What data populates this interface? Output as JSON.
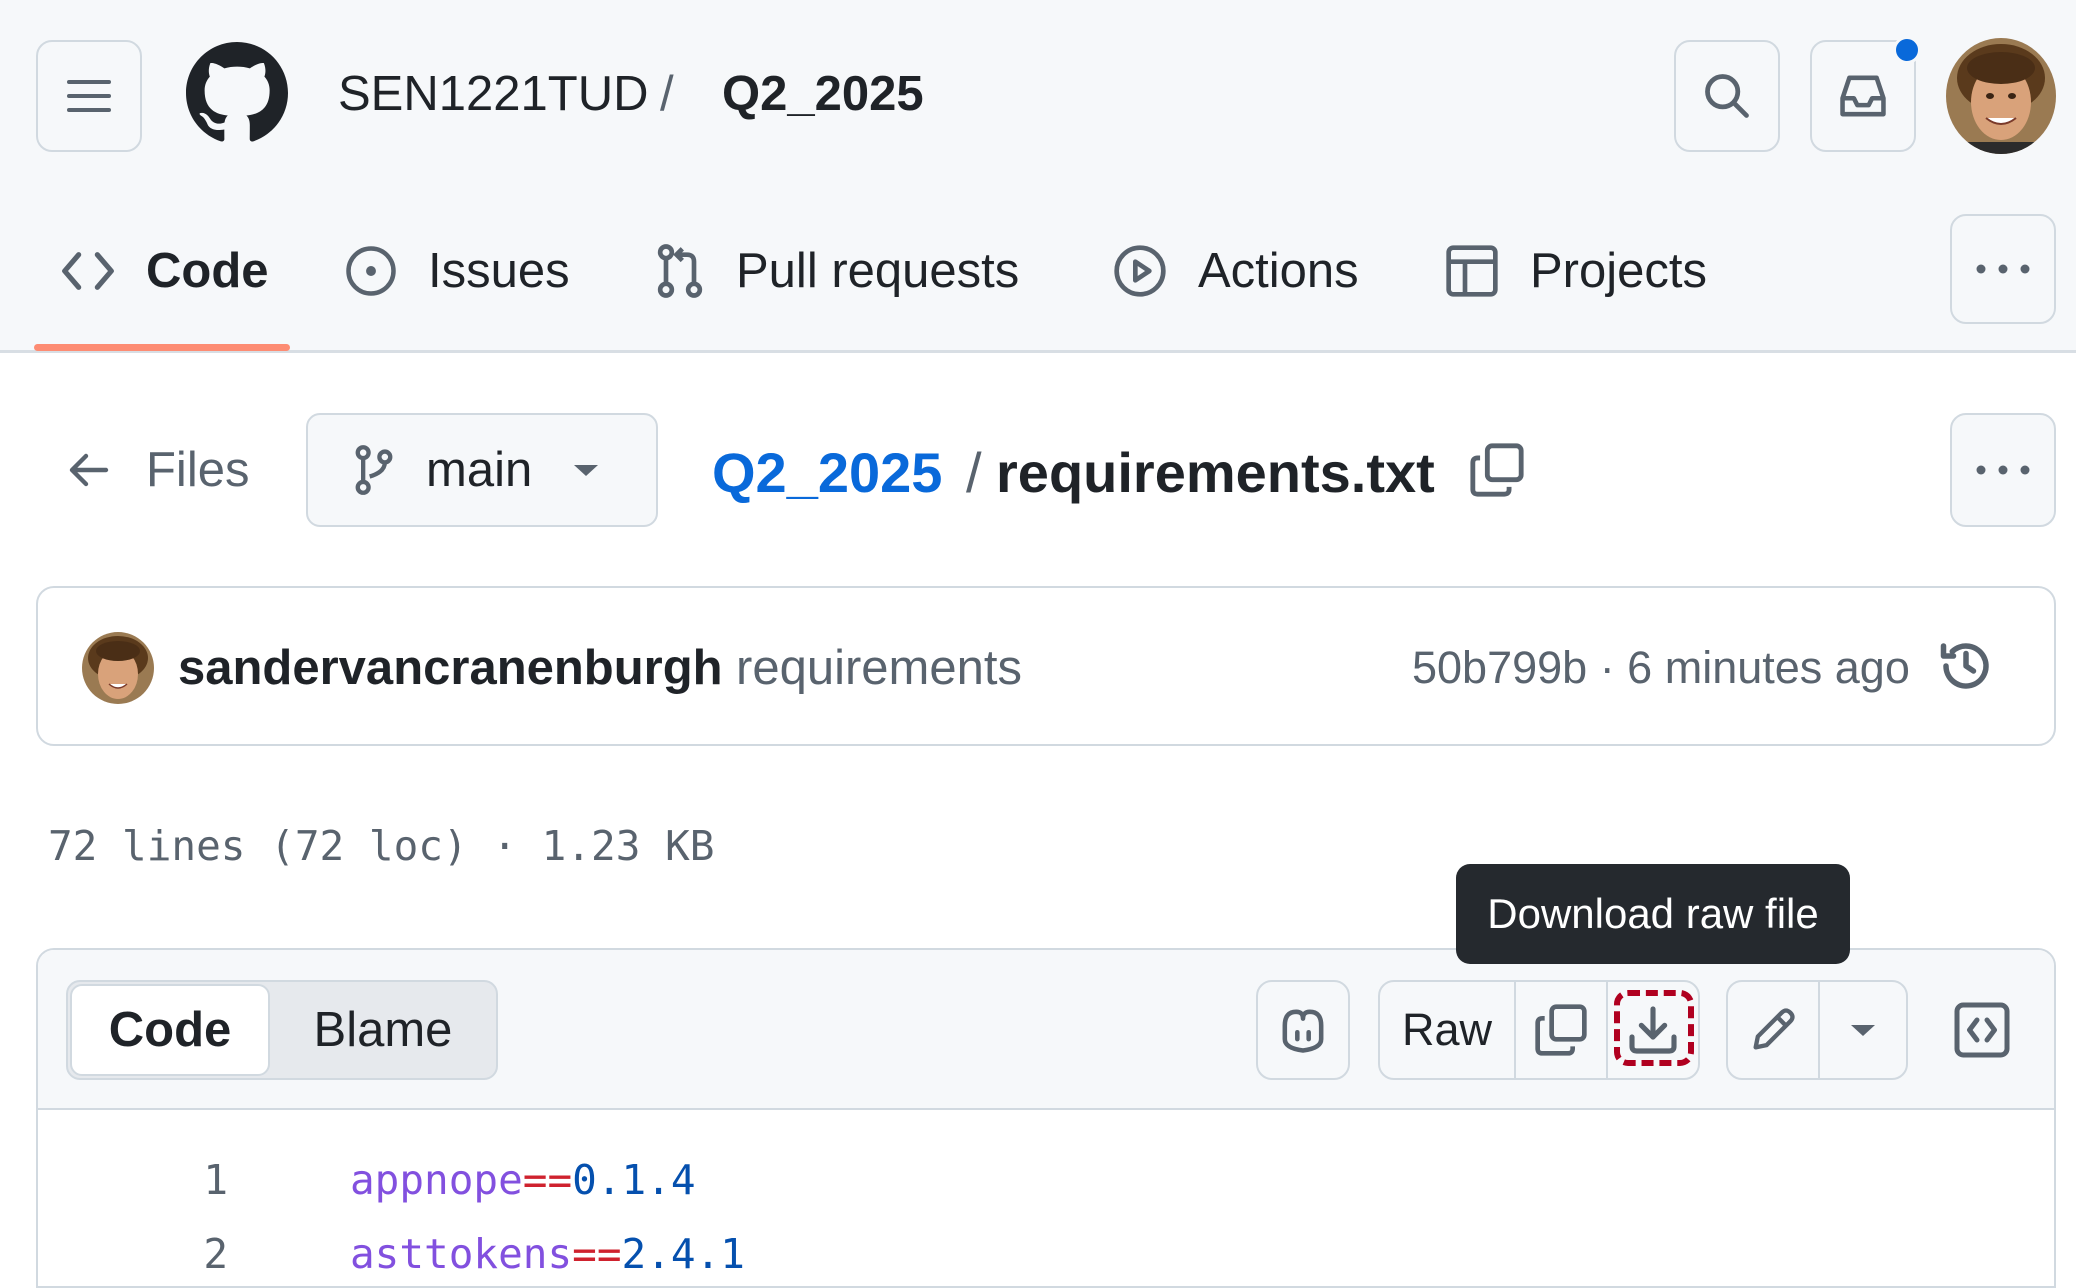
{
  "header": {
    "owner": "SEN1221TUD",
    "separator": "/",
    "repo": "Q2_2025"
  },
  "tabs": [
    {
      "label": "Code",
      "icon": "code-icon",
      "selected": true
    },
    {
      "label": "Issues",
      "icon": "issue-opened-icon"
    },
    {
      "label": "Pull requests",
      "icon": "git-pull-request-icon"
    },
    {
      "label": "Actions",
      "icon": "play-icon"
    },
    {
      "label": "Projects",
      "icon": "table-icon"
    }
  ],
  "breadcrumb": {
    "files_label": "Files",
    "branch": "main",
    "repo_link": "Q2_2025",
    "separator": "/",
    "filename": "requirements.txt"
  },
  "commit": {
    "author": "sandervancranenburgh",
    "message": "requirements",
    "meta": "50b799b · 6 minutes ago"
  },
  "file_info": "72 lines (72 loc) · 1.23 KB",
  "tooltip": "Download raw file",
  "viewer": {
    "code_tab": "Code",
    "blame_tab": "Blame",
    "raw_button": "Raw"
  },
  "lines": [
    {
      "num": "1",
      "pkg": "appnope",
      "op": "==",
      "ver": "0.1.4"
    },
    {
      "num": "2",
      "pkg": "asttokens",
      "op": "==",
      "ver": "2.4.1"
    }
  ],
  "colors": {
    "accent_blue": "#0969da",
    "tab_underline": "#fd8c73",
    "focus_ring": "#b00020"
  }
}
